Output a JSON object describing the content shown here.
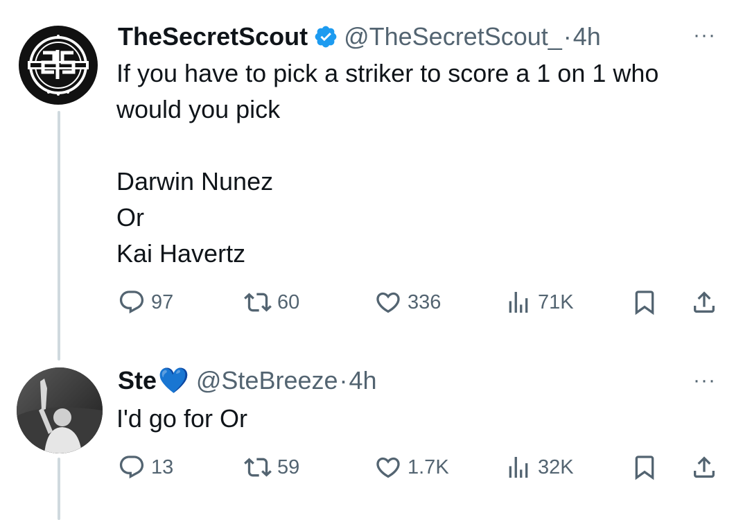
{
  "tweets": [
    {
      "author": "TheSecretScout",
      "handle": "@TheSecretScout_",
      "separator": "·",
      "time": "4h",
      "verified": true,
      "avatar_icon": "tss-logo-icon",
      "text": "If you have to pick a striker to score a 1 on 1 who\nwould you pick\n\nDarwin Nunez\nOr\nKai Havertz",
      "stats": {
        "replies": "97",
        "reposts": "60",
        "likes": "336",
        "views": "71K"
      },
      "more": "···"
    },
    {
      "author": "Ste",
      "author_emoji": "💙",
      "handle": "@SteBreeze",
      "separator": "·",
      "time": "4h",
      "verified": false,
      "avatar_icon": "user-photo-avatar",
      "text": "I'd go for Or",
      "stats": {
        "replies": "13",
        "reposts": "59",
        "likes": "1.7K",
        "views": "32K"
      },
      "more": "···"
    }
  ],
  "colors": {
    "text": "#0f1419",
    "secondary": "#536471",
    "verified": "#1d9bf0",
    "heart_emoji": "#1d9bf0",
    "thread_line": "#cfd9de"
  }
}
